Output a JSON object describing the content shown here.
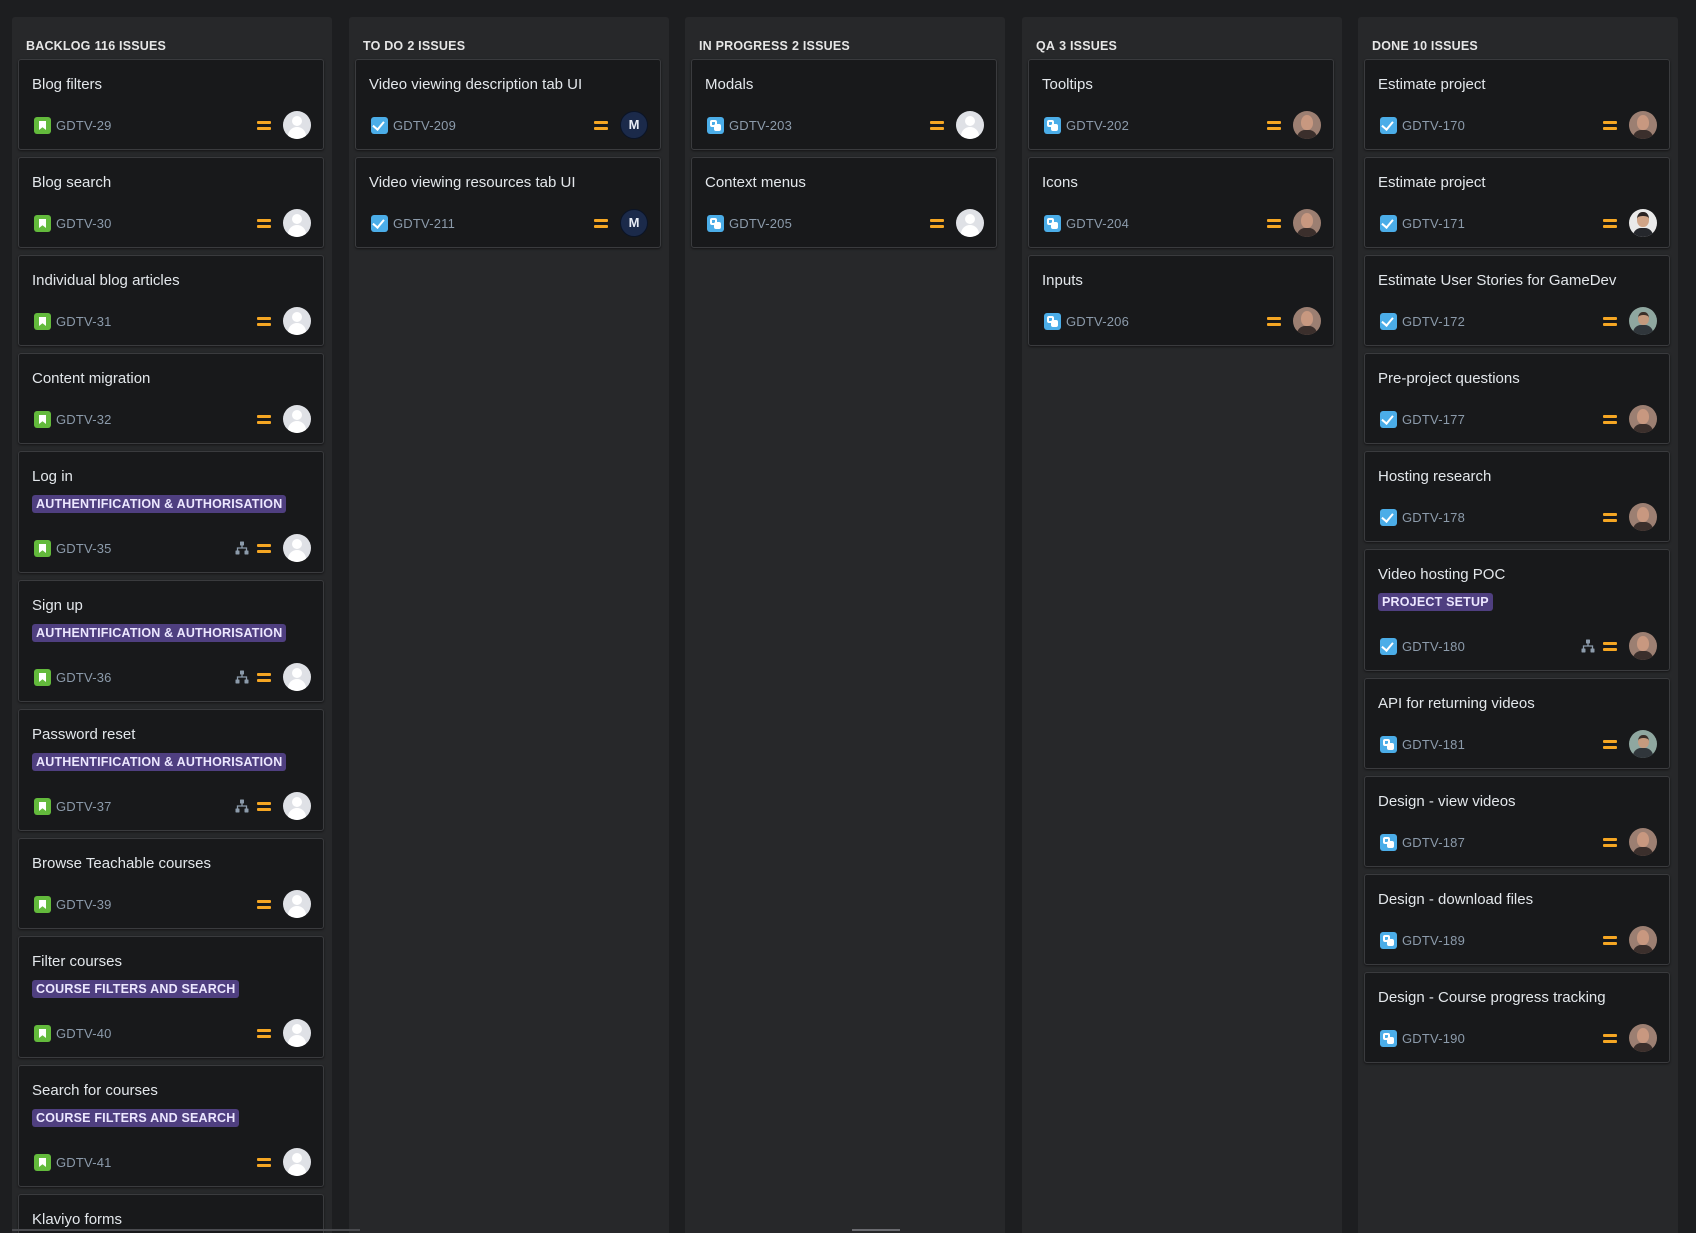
{
  "board": {
    "columns": [
      {
        "name": "BACKLOG",
        "count_label": "116 ISSUES",
        "cards": [
          {
            "title": "Blog filters",
            "key": "GDTV-29",
            "type": "story-icon",
            "priority": "medium-priority-icon",
            "avatar": "default-avatar"
          },
          {
            "title": "Blog search",
            "key": "GDTV-30",
            "type": "story-icon",
            "priority": "medium-priority-icon",
            "avatar": "default-avatar"
          },
          {
            "title": "Individual blog articles",
            "key": "GDTV-31",
            "type": "story-icon",
            "priority": "medium-priority-icon",
            "avatar": "default-avatar"
          },
          {
            "title": "Content migration",
            "key": "GDTV-32",
            "type": "story-icon",
            "priority": "medium-priority-icon",
            "avatar": "default-avatar"
          },
          {
            "title": "Log in",
            "epic": "AUTHENTIFICATION & AUTHORISATION",
            "key": "GDTV-35",
            "type": "story-icon",
            "priority": "medium-priority-icon",
            "has_children": true,
            "avatar": "default-avatar"
          },
          {
            "title": "Sign up",
            "epic": "AUTHENTIFICATION & AUTHORISATION",
            "key": "GDTV-36",
            "type": "story-icon",
            "priority": "medium-priority-icon",
            "has_children": true,
            "avatar": "default-avatar"
          },
          {
            "title": "Password reset",
            "epic": "AUTHENTIFICATION & AUTHORISATION",
            "key": "GDTV-37",
            "type": "story-icon",
            "priority": "medium-priority-icon",
            "has_children": true,
            "avatar": "default-avatar"
          },
          {
            "title": "Browse Teachable courses",
            "key": "GDTV-39",
            "type": "story-icon",
            "priority": "medium-priority-icon",
            "avatar": "default-avatar"
          },
          {
            "title": "Filter courses",
            "epic": "COURSE FILTERS AND SEARCH",
            "key": "GDTV-40",
            "type": "story-icon",
            "priority": "medium-priority-icon",
            "avatar": "default-avatar"
          },
          {
            "title": "Search for courses",
            "epic": "COURSE FILTERS AND SEARCH",
            "key": "GDTV-41",
            "type": "story-icon",
            "priority": "medium-priority-icon",
            "avatar": "default-avatar"
          },
          {
            "title": "Klaviyo forms",
            "key": "",
            "type": "",
            "priority": "",
            "avatar": ""
          }
        ]
      },
      {
        "name": "TO DO",
        "count_label": "2 ISSUES",
        "cards": [
          {
            "title": "Video viewing description tab UI",
            "key": "GDTV-209",
            "type": "task-icon",
            "priority": "medium-priority-icon",
            "avatar": "initials-avatar",
            "initials": "M"
          },
          {
            "title": "Video viewing resources tab UI",
            "key": "GDTV-211",
            "type": "task-icon",
            "priority": "medium-priority-icon",
            "avatar": "initials-avatar",
            "initials": "M"
          }
        ]
      },
      {
        "name": "IN PROGRESS",
        "count_label": "2 ISSUES",
        "cards": [
          {
            "title": "Modals",
            "key": "GDTV-203",
            "type": "subtask-icon",
            "priority": "medium-priority-icon",
            "avatar": "default-avatar"
          },
          {
            "title": "Context menus",
            "key": "GDTV-205",
            "type": "subtask-icon",
            "priority": "medium-priority-icon",
            "avatar": "default-avatar"
          }
        ]
      },
      {
        "name": "QA",
        "count_label": "3 ISSUES",
        "cards": [
          {
            "title": "Tooltips",
            "key": "GDTV-202",
            "type": "subtask-icon",
            "priority": "medium-priority-icon",
            "avatar": "photo-avatar-bald"
          },
          {
            "title": "Icons",
            "key": "GDTV-204",
            "type": "subtask-icon",
            "priority": "medium-priority-icon",
            "avatar": "photo-avatar-bald"
          },
          {
            "title": "Inputs",
            "key": "GDTV-206",
            "type": "subtask-icon",
            "priority": "medium-priority-icon",
            "avatar": "photo-avatar-bald"
          }
        ]
      },
      {
        "name": "DONE",
        "count_label": "10 ISSUES",
        "cards": [
          {
            "title": "Estimate project",
            "key": "GDTV-170",
            "type": "task-icon",
            "priority": "medium-priority-icon",
            "avatar": "photo-avatar-bald"
          },
          {
            "title": "Estimate project",
            "key": "GDTV-171",
            "type": "task-icon",
            "priority": "medium-priority-icon",
            "avatar": "photo-avatar-dark-hair"
          },
          {
            "title": "Estimate User Stories for GameDev",
            "key": "GDTV-172",
            "type": "task-icon",
            "priority": "medium-priority-icon",
            "avatar": "photo-avatar-outdoor"
          },
          {
            "title": "Pre-project questions",
            "key": "GDTV-177",
            "type": "task-icon",
            "priority": "medium-priority-icon",
            "avatar": "photo-avatar-bald"
          },
          {
            "title": "Hosting research",
            "key": "GDTV-178",
            "type": "task-icon",
            "priority": "medium-priority-icon",
            "avatar": "photo-avatar-bald"
          },
          {
            "title": "Video hosting POC",
            "epic": "PROJECT SETUP",
            "key": "GDTV-180",
            "type": "task-icon",
            "priority": "medium-priority-icon",
            "has_children": true,
            "avatar": "photo-avatar-bald"
          },
          {
            "title": "API for returning videos",
            "key": "GDTV-181",
            "type": "subtask-icon",
            "priority": "medium-priority-icon",
            "avatar": "photo-avatar-outdoor"
          },
          {
            "title": "Design - view videos",
            "key": "GDTV-187",
            "type": "subtask-icon",
            "priority": "medium-priority-icon",
            "avatar": "photo-avatar-bald"
          },
          {
            "title": "Design - download files",
            "key": "GDTV-189",
            "type": "subtask-icon",
            "priority": "medium-priority-icon",
            "avatar": "photo-avatar-bald"
          },
          {
            "title": "Design - Course progress tracking",
            "key": "GDTV-190",
            "type": "subtask-icon",
            "priority": "medium-priority-icon",
            "avatar": "photo-avatar-bald"
          }
        ]
      }
    ]
  },
  "colors": {
    "background": "#1d1e20",
    "column": "#27282a",
    "card": "#18191b",
    "story": "#63ba3c",
    "task": "#4bade8",
    "priority_medium": "#f5a623",
    "epic_label": "#4f3f80"
  }
}
